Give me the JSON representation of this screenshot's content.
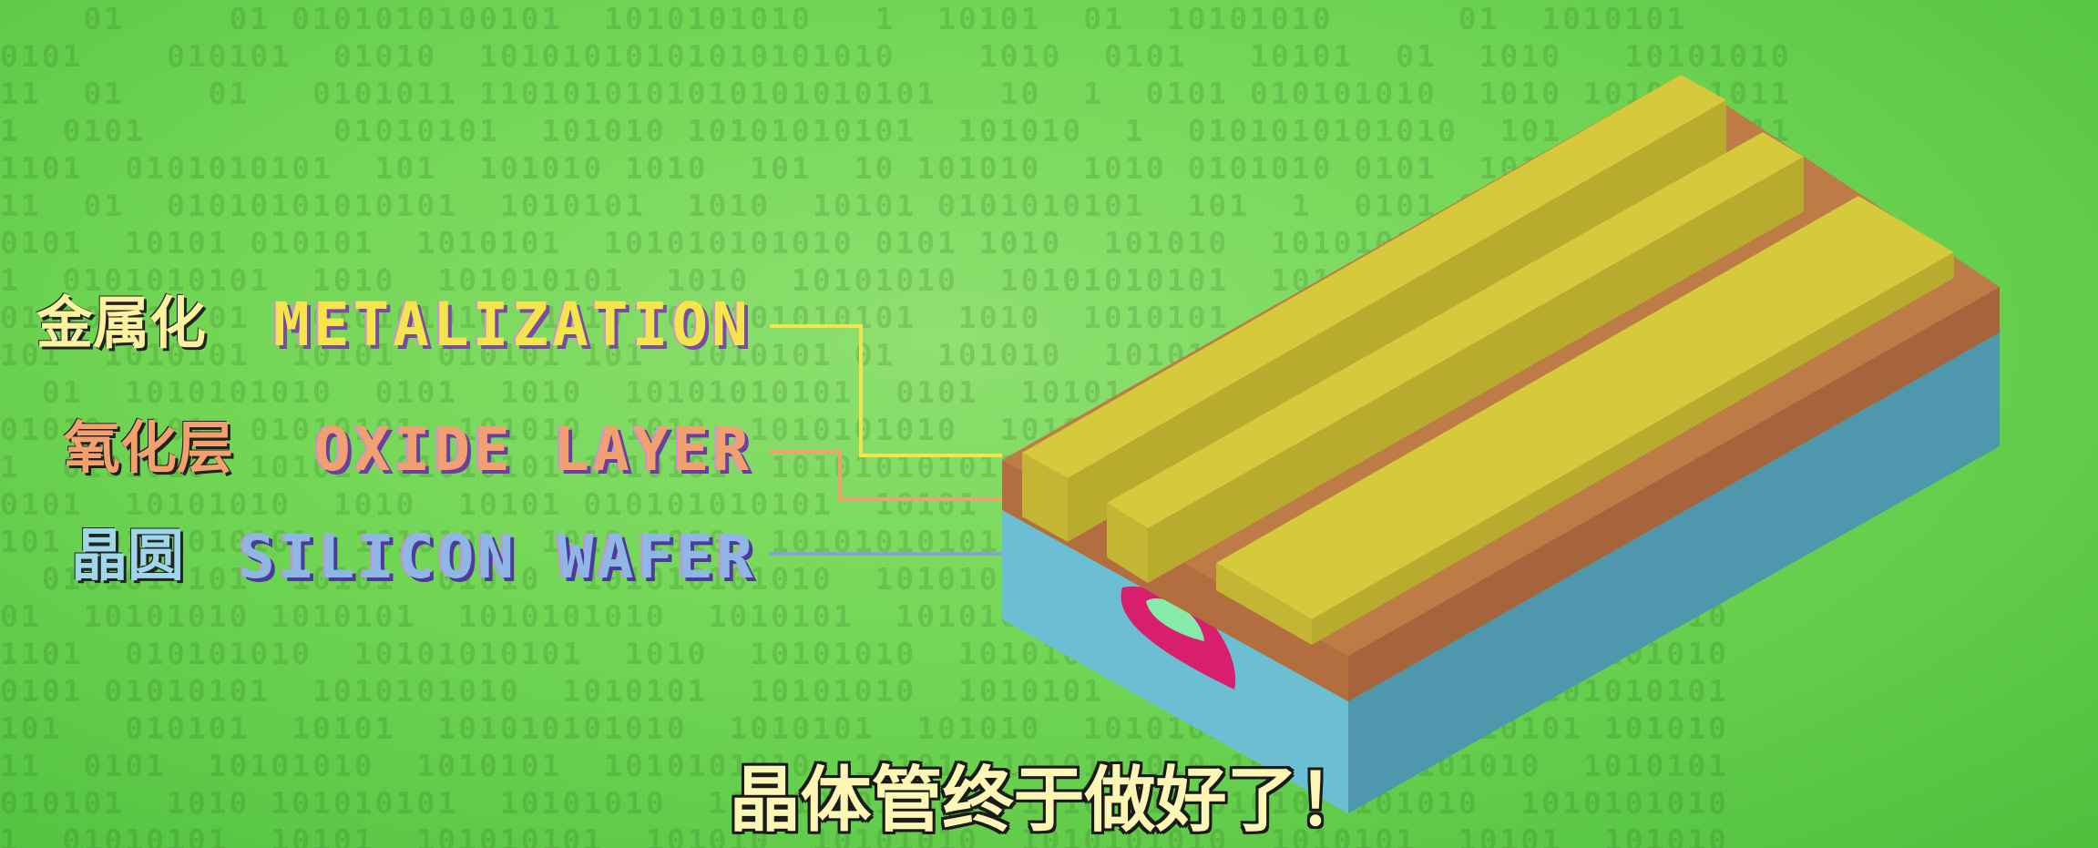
{
  "background_binary": [
    "    01     01 0101010100101  1010101010   1  10101  01  10101010      01  1010101",
    "0101    010101  01010  10101010101010101010    1010  0101   10101  01  1010   10101010",
    "11  01    01   0101011 1101010101010101010101   10  1  0101 010101010  1010 1010  1011",
    "1  0101         01010101  101010 10101010101  101010  1  0101010101010  101   10  1011",
    "1101  0101010101  101  101010 1010  101  10 101010  1010 0101010 0101  1010  1010101010",
    "11  01  01010101010101  1010101  1010  10101 0101010101  101  1  0101 01010  1010 1010",
    "0101  10101 010101  1010101  101010101010 0101 1010  101010  10101010 1010 10101  10",
    "1  0101010101  1010  101010101  1010  10101010  10101010101  1010 101010  1010  101010",
    "01010101  01  1010101010  1010  010101010101  1010  1010101  10101 0101010 101  101",
    "101  1010101  10101  010101 101  1010101 01  101010  101010  10101010  1010  1010101",
    "  01  1010101010  0101  1010  10101010101  0101  10101  1010  1010101  10101  10101",
    "01010  101  01010101  101010  1010  1010101010  101010  10101  1010  101010 1010101",
    "1  0101010  10101  01010101 1010101  1010101010101  1010  101010  10101  1010101010",
    "0101  10101010  1010  10101 010101010101  10101  1010101  10101010  1010 1010101010",
    "101  0101010101  1010101  1010 1010  10101010101  101010  1010101  10101  101010101",
    "  0101010101  10101  01010  101010101010  1010101  1010  1010101010  1010  10101010",
    "01  10101010 1010101  1010101010  1010101  10101010101  1010 101010  10101010  1010",
    "1101  010101010  10101010101  1010  10101010  101010101  10101  1010101  1010101010",
    "0101 01010101  1010101010  1010101  10101010  1010101  101010101  10101 10101010101",
    "101   010101  10101  101010101010  1010101  101010  1010101010  10101  10101 101010",
    "11  0101  10101010  1010101  1010101010  10101  1010101010 1010101  101010  1010101",
    "010101  1010 101010101  10101010  1010101010101  1010  10101010  101010  1010101010",
    "1  01010101  10101  101010101  101010  10101010  1010101010  1010101  10101  101010"
  ],
  "labels": {
    "metallization": {
      "cn": "金属化",
      "en": "METALIZATION",
      "color": "#f4e54a"
    },
    "oxide_layer": {
      "cn": "氧化层",
      "en": "OXIDE LAYER",
      "color": "#f1a170"
    },
    "silicon_wafer": {
      "cn": "晶圆",
      "en": "SILICON WAFER",
      "color": "#8fb7e6"
    }
  },
  "diagram_colors": {
    "metal_top": "#d7c93c",
    "metal_side": "#b8ab2d",
    "metal_front": "#c4b634",
    "oxide_top": "#bd7b45",
    "oxide_side": "#a5643b",
    "oxide_front": "#b36e40",
    "silicon_front": "#6cbfd2",
    "silicon_side": "#4e97ad",
    "doped_outer": "#d81e6c",
    "doped_inner": "#86ebaa"
  },
  "subtitle": "晶体管终于做好了！"
}
